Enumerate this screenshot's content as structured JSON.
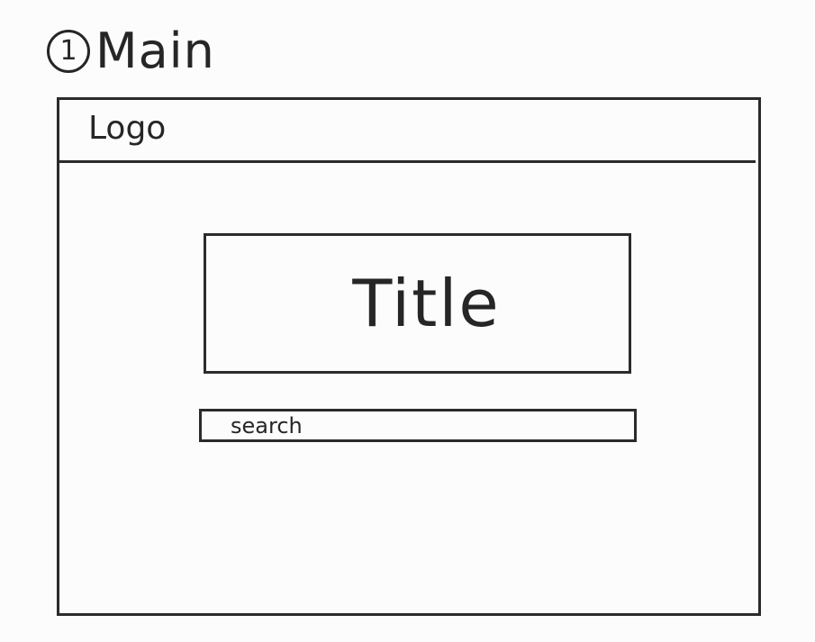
{
  "sketch": {
    "number": "1",
    "label": "Main"
  },
  "header": {
    "logo": "Logo"
  },
  "main": {
    "title": "Title",
    "search": {
      "placeholder": "search",
      "value": ""
    }
  }
}
